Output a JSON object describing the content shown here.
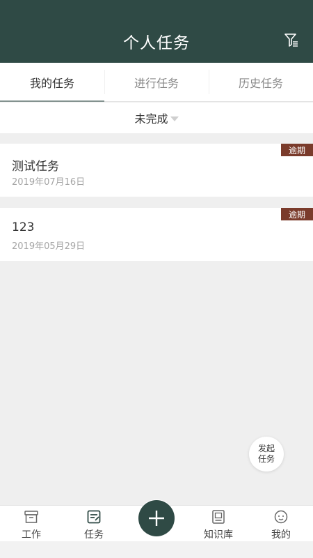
{
  "header": {
    "title": "个人任务",
    "filter_icon": "filter-icon"
  },
  "tabs": [
    {
      "label": "我的任务",
      "active": true
    },
    {
      "label": "进行任务",
      "active": false
    },
    {
      "label": "历史任务",
      "active": false
    }
  ],
  "status_filter": {
    "value": "未完成"
  },
  "tasks": [
    {
      "title": "测试任务",
      "date": "2019年07月16日",
      "badge": "逾期"
    },
    {
      "title": "123",
      "date": "2019年05月29日",
      "badge": "逾期"
    }
  ],
  "launch_button": {
    "line1": "发起",
    "line2": "任务"
  },
  "bottom_nav": {
    "items": [
      {
        "label": "工作",
        "icon": "briefcase-icon"
      },
      {
        "label": "任务",
        "icon": "task-icon"
      },
      {
        "label": "知识库",
        "icon": "book-icon"
      },
      {
        "label": "我的",
        "icon": "profile-icon"
      }
    ],
    "center_icon": "plus-icon"
  },
  "colors": {
    "primary": "#2f4a45",
    "badge": "#7a3b2b",
    "background": "#efefef"
  }
}
